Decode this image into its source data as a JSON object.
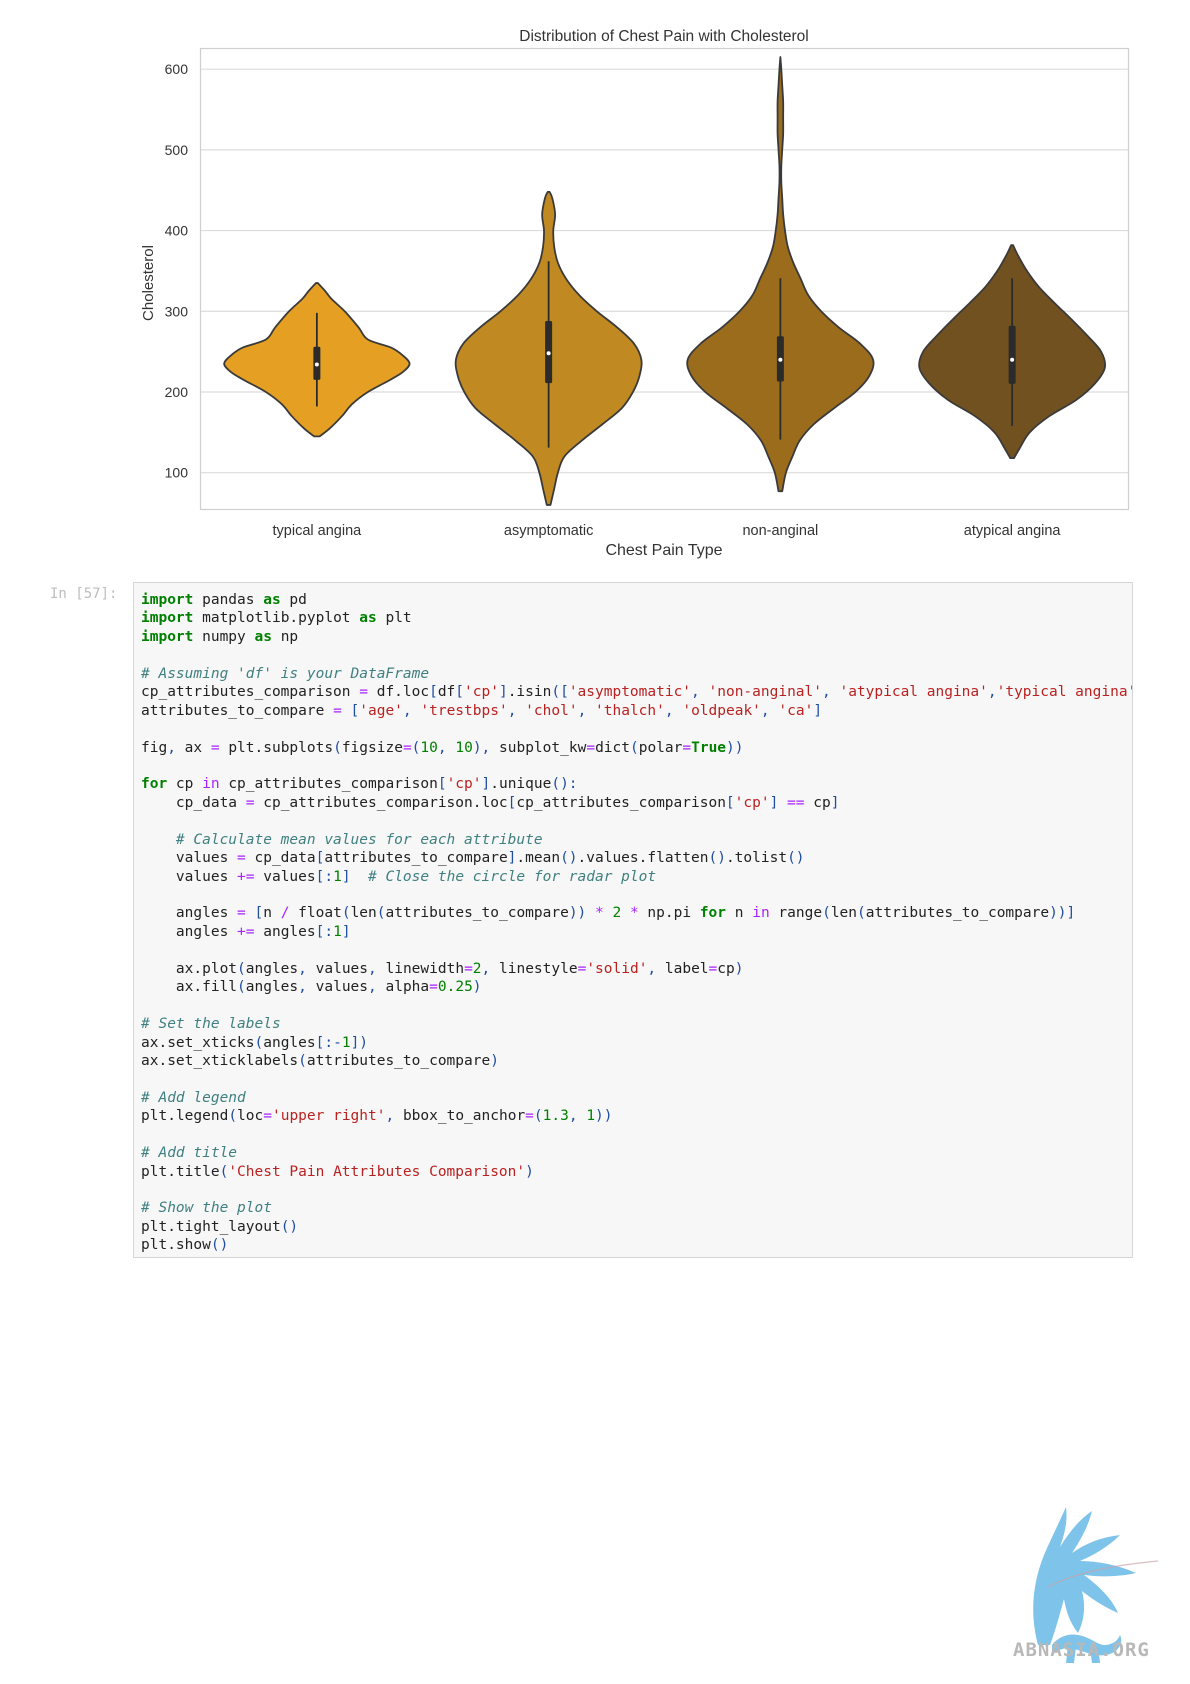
{
  "chart_data": {
    "type": "violin",
    "title": "Distribution of Chest Pain with Cholesterol",
    "xlabel": "Chest Pain Type",
    "ylabel": "Cholesterol",
    "ylim": [
      55,
      625
    ],
    "yticks": [
      100,
      200,
      300,
      400,
      500,
      600
    ],
    "grid": true,
    "categories": [
      "typical angina",
      "asymptomatic",
      "non-anginal",
      "atypical angina"
    ],
    "colors": [
      "#e5a023",
      "#c08922",
      "#9b6c1c",
      "#725120"
    ],
    "series": [
      {
        "category": "typical angina",
        "min": 145,
        "max": 335,
        "whisker_low": 182,
        "whisker_high": 298,
        "q1": 215,
        "median": 234,
        "q3": 256,
        "density_y": [
          145,
          155,
          170,
          185,
          200,
          215,
          225,
          235,
          245,
          255,
          265,
          280,
          300,
          315,
          325,
          335
        ],
        "density_w": [
          0.03,
          0.14,
          0.27,
          0.38,
          0.55,
          0.79,
          0.93,
          1.0,
          0.93,
          0.8,
          0.55,
          0.45,
          0.3,
          0.16,
          0.09,
          0.01
        ]
      },
      {
        "category": "asymptomatic",
        "min": 60,
        "max": 448,
        "whisker_low": 131,
        "whisker_high": 362,
        "q1": 211,
        "median": 248,
        "q3": 288,
        "density_y": [
          60,
          80,
          100,
          120,
          140,
          160,
          180,
          200,
          220,
          240,
          260,
          280,
          300,
          320,
          340,
          360,
          380,
          400,
          420,
          440,
          448
        ],
        "density_w": [
          0.02,
          0.06,
          0.1,
          0.17,
          0.36,
          0.58,
          0.79,
          0.91,
          0.98,
          1.0,
          0.92,
          0.74,
          0.52,
          0.33,
          0.19,
          0.1,
          0.06,
          0.05,
          0.07,
          0.04,
          0.01
        ]
      },
      {
        "category": "non-anginal",
        "min": 77,
        "max": 615,
        "whisker_low": 141,
        "whisker_high": 341,
        "q1": 213,
        "median": 240,
        "q3": 269,
        "density_y": [
          77,
          100,
          120,
          140,
          160,
          180,
          200,
          220,
          240,
          260,
          280,
          300,
          320,
          340,
          360,
          380,
          400,
          420,
          440,
          460,
          480,
          500,
          520,
          540,
          560,
          580,
          600,
          615
        ],
        "density_w": [
          0.02,
          0.06,
          0.13,
          0.21,
          0.36,
          0.58,
          0.81,
          0.96,
          1.0,
          0.86,
          0.63,
          0.44,
          0.3,
          0.22,
          0.14,
          0.08,
          0.05,
          0.03,
          0.02,
          0.01,
          0.01,
          0.02,
          0.03,
          0.03,
          0.03,
          0.02,
          0.01,
          0.0
        ]
      },
      {
        "category": "atypical angina",
        "min": 118,
        "max": 382,
        "whisker_low": 158,
        "whisker_high": 341,
        "q1": 210,
        "median": 240,
        "q3": 282,
        "density_y": [
          118,
          130,
          150,
          170,
          190,
          210,
          230,
          250,
          270,
          290,
          310,
          330,
          350,
          370,
          382
        ],
        "density_w": [
          0.02,
          0.08,
          0.19,
          0.4,
          0.69,
          0.89,
          1.0,
          0.96,
          0.81,
          0.64,
          0.46,
          0.29,
          0.16,
          0.06,
          0.01
        ]
      }
    ]
  },
  "notebook": {
    "prompt": "In [57]:",
    "code_lines": [
      [
        [
          "kw",
          "import"
        ],
        [
          "t",
          " pandas "
        ],
        [
          "kw",
          "as"
        ],
        [
          "t",
          " pd"
        ]
      ],
      [
        [
          "kw",
          "import"
        ],
        [
          "t",
          " matplotlib.pyplot "
        ],
        [
          "kw",
          "as"
        ],
        [
          "t",
          " plt"
        ]
      ],
      [
        [
          "kw",
          "import"
        ],
        [
          "t",
          " numpy "
        ],
        [
          "kw",
          "as"
        ],
        [
          "t",
          " np"
        ]
      ],
      [],
      [
        [
          "cm",
          "# Assuming 'df' is your DataFrame"
        ]
      ],
      [
        [
          "t",
          "cp_attributes_comparison "
        ],
        [
          "op",
          "="
        ],
        [
          "t",
          " df.loc"
        ],
        [
          "p",
          "["
        ],
        [
          "t",
          "df"
        ],
        [
          "p",
          "["
        ],
        [
          "str",
          "'cp'"
        ],
        [
          "p",
          "]"
        ],
        [
          "t",
          ".isin"
        ],
        [
          "p",
          "(["
        ],
        [
          "str",
          "'asymptomatic'"
        ],
        [
          "p",
          ", "
        ],
        [
          "str",
          "'non-anginal'"
        ],
        [
          "p",
          ", "
        ],
        [
          "str",
          "'atypical angina'"
        ],
        [
          "p",
          ","
        ],
        [
          "str",
          "'typical angina'"
        ],
        [
          "p",
          "])]"
        ]
      ],
      [
        [
          "t",
          "attributes_to_compare "
        ],
        [
          "op",
          "="
        ],
        [
          "t",
          " "
        ],
        [
          "p",
          "["
        ],
        [
          "str",
          "'age'"
        ],
        [
          "p",
          ", "
        ],
        [
          "str",
          "'trestbps'"
        ],
        [
          "p",
          ", "
        ],
        [
          "str",
          "'chol'"
        ],
        [
          "p",
          ", "
        ],
        [
          "str",
          "'thalch'"
        ],
        [
          "p",
          ", "
        ],
        [
          "str",
          "'oldpeak'"
        ],
        [
          "p",
          ", "
        ],
        [
          "str",
          "'ca'"
        ],
        [
          "p",
          "]"
        ]
      ],
      [],
      [
        [
          "t",
          "fig"
        ],
        [
          "p",
          ","
        ],
        [
          "t",
          " ax "
        ],
        [
          "op",
          "="
        ],
        [
          "t",
          " plt.subplots"
        ],
        [
          "p",
          "("
        ],
        [
          "t",
          "figsize"
        ],
        [
          "op",
          "="
        ],
        [
          "p",
          "("
        ],
        [
          "num",
          "10"
        ],
        [
          "p",
          ", "
        ],
        [
          "num",
          "10"
        ],
        [
          "p",
          "), "
        ],
        [
          "t",
          "subplot_kw"
        ],
        [
          "op",
          "="
        ],
        [
          "t",
          "dict"
        ],
        [
          "p",
          "("
        ],
        [
          "t",
          "polar"
        ],
        [
          "op",
          "="
        ],
        [
          "kw",
          "True"
        ],
        [
          "p",
          "))"
        ]
      ],
      [],
      [
        [
          "kw",
          "for"
        ],
        [
          "t",
          " cp "
        ],
        [
          "op",
          "in"
        ],
        [
          "t",
          " cp_attributes_comparison"
        ],
        [
          "p",
          "["
        ],
        [
          "str",
          "'cp'"
        ],
        [
          "p",
          "]"
        ],
        [
          "t",
          ".unique"
        ],
        [
          "p",
          "():"
        ]
      ],
      [
        [
          "t",
          "    cp_data "
        ],
        [
          "op",
          "="
        ],
        [
          "t",
          " cp_attributes_comparison.loc"
        ],
        [
          "p",
          "["
        ],
        [
          "t",
          "cp_attributes_comparison"
        ],
        [
          "p",
          "["
        ],
        [
          "str",
          "'cp'"
        ],
        [
          "p",
          "]"
        ],
        [
          "t",
          " "
        ],
        [
          "op",
          "=="
        ],
        [
          "t",
          " cp"
        ],
        [
          "p",
          "]"
        ]
      ],
      [],
      [
        [
          "t",
          "    "
        ],
        [
          "cm",
          "# Calculate mean values for each attribute"
        ]
      ],
      [
        [
          "t",
          "    values "
        ],
        [
          "op",
          "="
        ],
        [
          "t",
          " cp_data"
        ],
        [
          "p",
          "["
        ],
        [
          "t",
          "attributes_to_compare"
        ],
        [
          "p",
          "]"
        ],
        [
          "t",
          ".mean"
        ],
        [
          "p",
          "()"
        ],
        [
          "t",
          ".values.flatten"
        ],
        [
          "p",
          "()"
        ],
        [
          "t",
          ".tolist"
        ],
        [
          "p",
          "()"
        ]
      ],
      [
        [
          "t",
          "    values "
        ],
        [
          "op",
          "+="
        ],
        [
          "t",
          " values"
        ],
        [
          "p",
          "[:"
        ],
        [
          "num",
          "1"
        ],
        [
          "p",
          "]"
        ],
        [
          "t",
          "  "
        ],
        [
          "cm",
          "# Close the circle for radar plot"
        ]
      ],
      [],
      [
        [
          "t",
          "    angles "
        ],
        [
          "op",
          "="
        ],
        [
          "t",
          " "
        ],
        [
          "p",
          "["
        ],
        [
          "t",
          "n "
        ],
        [
          "op",
          "/"
        ],
        [
          "t",
          " float"
        ],
        [
          "p",
          "("
        ],
        [
          "t",
          "len"
        ],
        [
          "p",
          "("
        ],
        [
          "t",
          "attributes_to_compare"
        ],
        [
          "p",
          "))"
        ],
        [
          "t",
          " "
        ],
        [
          "op",
          "*"
        ],
        [
          "t",
          " "
        ],
        [
          "num",
          "2"
        ],
        [
          "t",
          " "
        ],
        [
          "op",
          "*"
        ],
        [
          "t",
          " np.pi "
        ],
        [
          "kw",
          "for"
        ],
        [
          "t",
          " n "
        ],
        [
          "op",
          "in"
        ],
        [
          "t",
          " range"
        ],
        [
          "p",
          "("
        ],
        [
          "t",
          "len"
        ],
        [
          "p",
          "("
        ],
        [
          "t",
          "attributes_to_compare"
        ],
        [
          "p",
          "))]"
        ]
      ],
      [
        [
          "t",
          "    angles "
        ],
        [
          "op",
          "+="
        ],
        [
          "t",
          " angles"
        ],
        [
          "p",
          "[:"
        ],
        [
          "num",
          "1"
        ],
        [
          "p",
          "]"
        ]
      ],
      [],
      [
        [
          "t",
          "    ax.plot"
        ],
        [
          "p",
          "("
        ],
        [
          "t",
          "angles"
        ],
        [
          "p",
          ", "
        ],
        [
          "t",
          "values"
        ],
        [
          "p",
          ", "
        ],
        [
          "t",
          "linewidth"
        ],
        [
          "op",
          "="
        ],
        [
          "num",
          "2"
        ],
        [
          "p",
          ", "
        ],
        [
          "t",
          "linestyle"
        ],
        [
          "op",
          "="
        ],
        [
          "str",
          "'solid'"
        ],
        [
          "p",
          ", "
        ],
        [
          "t",
          "label"
        ],
        [
          "op",
          "="
        ],
        [
          "t",
          "cp"
        ],
        [
          "p",
          ")"
        ]
      ],
      [
        [
          "t",
          "    ax.fill"
        ],
        [
          "p",
          "("
        ],
        [
          "t",
          "angles"
        ],
        [
          "p",
          ", "
        ],
        [
          "t",
          "values"
        ],
        [
          "p",
          ", "
        ],
        [
          "t",
          "alpha"
        ],
        [
          "op",
          "="
        ],
        [
          "num",
          "0.25"
        ],
        [
          "p",
          ")"
        ]
      ],
      [],
      [
        [
          "cm",
          "# Set the labels"
        ]
      ],
      [
        [
          "t",
          "ax.set_xticks"
        ],
        [
          "p",
          "("
        ],
        [
          "t",
          "angles"
        ],
        [
          "p",
          "[:-"
        ],
        [
          "num",
          "1"
        ],
        [
          "p",
          "])"
        ]
      ],
      [
        [
          "t",
          "ax.set_xticklabels"
        ],
        [
          "p",
          "("
        ],
        [
          "t",
          "attributes_to_compare"
        ],
        [
          "p",
          ")"
        ]
      ],
      [],
      [
        [
          "cm",
          "# Add legend"
        ]
      ],
      [
        [
          "t",
          "plt.legend"
        ],
        [
          "p",
          "("
        ],
        [
          "t",
          "loc"
        ],
        [
          "op",
          "="
        ],
        [
          "str",
          "'upper right'"
        ],
        [
          "p",
          ", "
        ],
        [
          "t",
          "bbox_to_anchor"
        ],
        [
          "op",
          "="
        ],
        [
          "p",
          "("
        ],
        [
          "num",
          "1.3"
        ],
        [
          "p",
          ", "
        ],
        [
          "num",
          "1"
        ],
        [
          "p",
          "))"
        ]
      ],
      [],
      [
        [
          "cm",
          "# Add title"
        ]
      ],
      [
        [
          "t",
          "plt.title"
        ],
        [
          "p",
          "("
        ],
        [
          "str",
          "'Chest Pain Attributes Comparison'"
        ],
        [
          "p",
          ")"
        ]
      ],
      [],
      [
        [
          "cm",
          "# Show the plot"
        ]
      ],
      [
        [
          "t",
          "plt.tight_layout"
        ],
        [
          "p",
          "()"
        ]
      ],
      [
        [
          "t",
          "plt.show"
        ],
        [
          "p",
          "()"
        ]
      ]
    ]
  },
  "watermark": {
    "text": "ABNASIA.ORG",
    "icon": "griffin-logo-icon",
    "color": "#7ec3ea"
  }
}
